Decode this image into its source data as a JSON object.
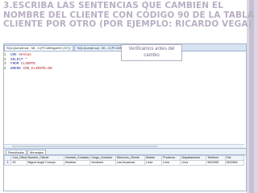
{
  "slide": {
    "title": "3.Escriba las sentencias que cambien el nombre del cliente con código 90 de la tabla cliente por otro (por ejemplo: Ricardo Vega)"
  },
  "callout": {
    "text": "Verificamos antes del cambio"
  },
  "editor": {
    "tabs": [
      "SQLQuery8.sql - MI...3 (PC18Miguel\\D (57))*",
      "SQLQuery8.sql - MI...3 (PC18Miguel (58))*",
      "SQLQuery3.sql..."
    ],
    "lines": [
      {
        "num": "1",
        "kw": "USE",
        "rest": " Ventas"
      },
      {
        "num": "2",
        "kw": "SELECT",
        "rest": " *"
      },
      {
        "num": "3",
        "kw": "FROM",
        "rest": " CLIENTE"
      },
      {
        "num": "4",
        "kw": "WHERE",
        "rest": " COD_CLIENTE=90"
      }
    ]
  },
  "results": {
    "tabs": [
      "Resultados",
      "Mensajes"
    ],
    "columns": [
      "Cod_Cliente",
      "Nombre_Cliente",
      "Nombre_Contacto",
      "Cargo_Contacto",
      "Direccion_Cliente",
      "Distrito",
      "Provincia",
      "Departamento",
      "Telefono",
      "Fax"
    ],
    "rows": [
      {
        "num": "1",
        "cells": [
          "90",
          "Miguel Angel Cornejo",
          "Beatrice",
          "Vendedor",
          "Las Acucenas",
          "Lince",
          "Lima",
          "Lima",
          "5522555",
          "5632663"
        ]
      }
    ]
  }
}
